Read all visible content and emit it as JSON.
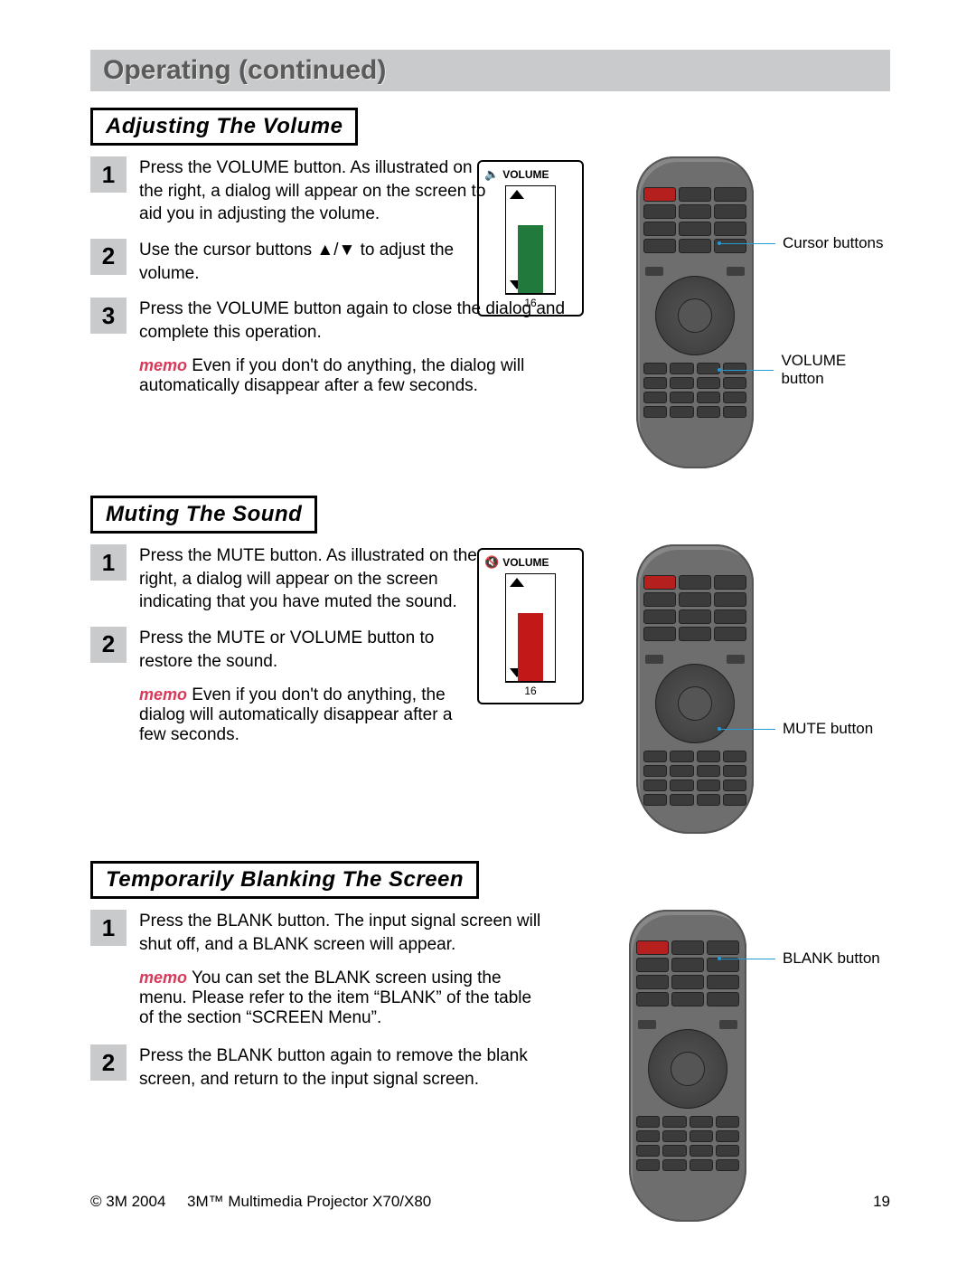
{
  "header": "Operating (continued)",
  "sections": {
    "volume": {
      "title": "Adjusting The Volume",
      "steps": {
        "s1": "Press the VOLUME button. As illustrated on the right, a dialog will appear on the screen to aid you in adjusting the volume.",
        "s2": "Use the cursor buttons ▲/▼ to adjust the volume.",
        "s3": "Press the VOLUME button again to close the dialog and complete this operation."
      },
      "memo_label": "memo",
      "memo": " Even if you don't do anything, the dialog will automatically disappear after a few seconds.",
      "dialog_label": "VOLUME",
      "dialog_value": "16",
      "callout1": "Cursor buttons",
      "callout2": "VOLUME button"
    },
    "mute": {
      "title": "Muting The Sound",
      "steps": {
        "s1": "Press the MUTE button. As illustrated on the right, a dialog will appear on the screen indicating that you have muted the sound.",
        "s2": "Press the MUTE or VOLUME button to restore the sound."
      },
      "memo_label": "memo",
      "memo": " Even if you don't do anything, the dialog will automatically disappear after a few seconds.",
      "dialog_label": "VOLUME",
      "dialog_value": "16",
      "callout": "MUTE button"
    },
    "blank": {
      "title": "Temporarily Blanking The Screen",
      "steps": {
        "s1": "Press the BLANK button. The input signal screen will shut off, and a BLANK screen will appear.",
        "s2": "Press the BLANK button again to remove the blank screen, and return to the input signal screen."
      },
      "memo_label": "memo",
      "memo": " You can set the BLANK screen using the menu. Please refer to the item “BLANK” of the table of the section “SCREEN Menu”.",
      "callout": "BLANK button"
    }
  },
  "nums": {
    "n1": "1",
    "n2": "2",
    "n3": "3"
  },
  "footer": {
    "left": "© 3M 2004     3M™ Multimedia Projector X70/X80",
    "right": "19"
  }
}
